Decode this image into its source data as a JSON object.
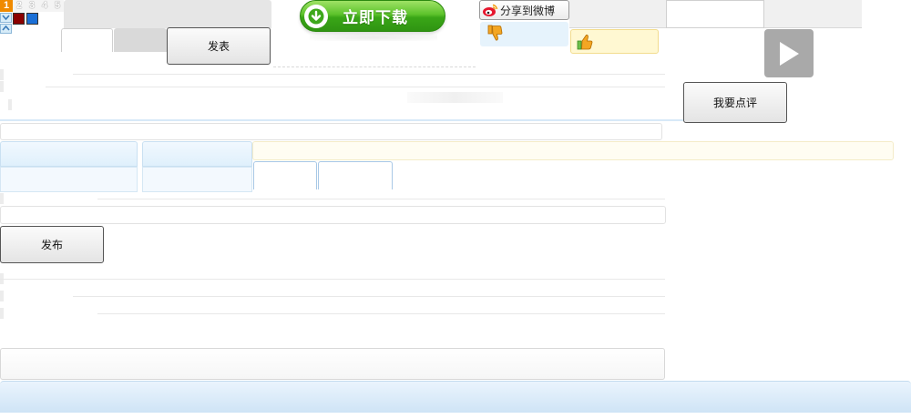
{
  "pager": {
    "pages": [
      "1",
      "2",
      "3",
      "4",
      "5"
    ],
    "active_page": "1"
  },
  "color_swatches": [
    "#8b0000",
    "#1a6fd6"
  ],
  "toolbar": {
    "publish_label": "发表",
    "download_label": "立即下载",
    "share_weibo_label": "分享到微博",
    "review_label": "我要点评",
    "post_label": "发布"
  },
  "icons": {
    "download": "down-arrow-circle-icon",
    "weibo": "weibo-icon",
    "thumbs_down": "thumbs-down-icon",
    "thumbs_up": "thumbs-up-icon",
    "play": "play-icon",
    "scroll_down": "chevron-down-icon",
    "scroll_up": "chevron-up-icon"
  },
  "colors": {
    "download_green": "#3aa617",
    "active_page_orange": "#f08a00",
    "thumb_down_orange": "#f3a623",
    "thumb_up_green": "#6cc04a",
    "bottom_bar_blue": "#d8eaf8"
  }
}
